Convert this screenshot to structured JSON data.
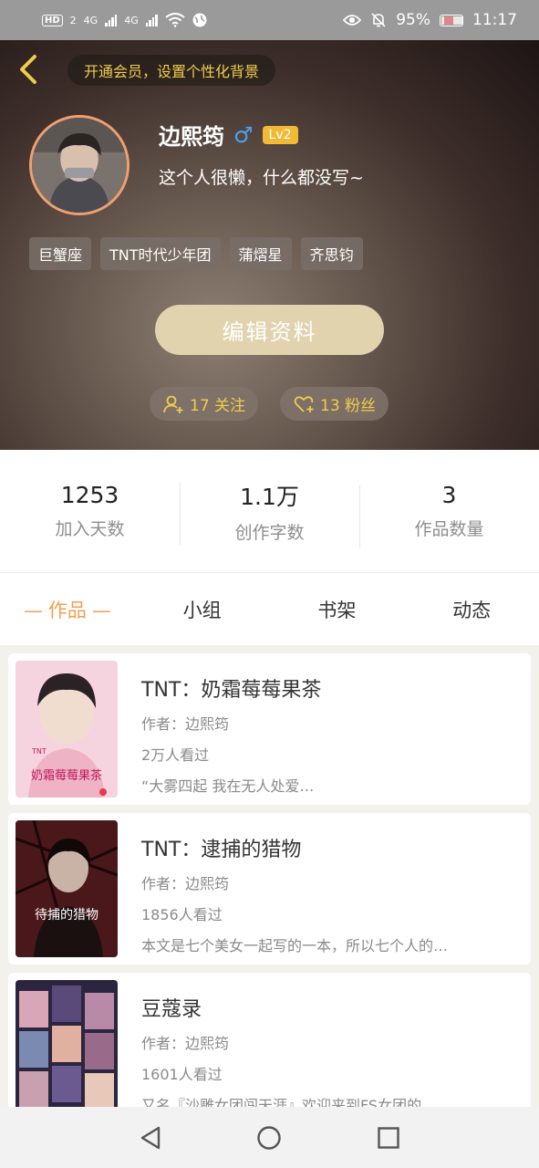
{
  "status_bar": {
    "hd": "HD",
    "sim": "2",
    "net1": "4G",
    "net2": "4G",
    "battery": "95%",
    "time": "11:17"
  },
  "header": {
    "vip_banner": "开通会员，设置个性化背景",
    "username": "边熙筠",
    "gender": "♂",
    "level": "Lv2",
    "bio": "这个人很懒，什么都没写~",
    "tags": [
      "巨蟹座",
      "TNT时代少年团",
      "蒲熠星",
      "齐思钧"
    ],
    "edit_label": "编辑资料",
    "following": "17 关注",
    "fans": "13 粉丝"
  },
  "stats": [
    {
      "value": "1253",
      "label": "加入天数"
    },
    {
      "value": "1.1万",
      "label": "创作字数"
    },
    {
      "value": "3",
      "label": "作品数量"
    }
  ],
  "tabs": [
    "作品",
    "小组",
    "书架",
    "动态"
  ],
  "works": [
    {
      "title": "TNT：奶霜莓莓果茶",
      "author": "作者：边熙筠",
      "views": "2万人看过",
      "summary": "“大雾四起 我在无人处爱…",
      "cover_text": "奶霜莓莓果茶",
      "cover_badge": "TNT"
    },
    {
      "title": "TNT：逮捕的猎物",
      "author": "作者：边熙筠",
      "views": "1856人看过",
      "summary": "本文是七个美女一起写的一本，所以七个人的…",
      "cover_text": "待捕的猎物"
    },
    {
      "title": "豆蔻录",
      "author": "作者：边熙筠",
      "views": "1601人看过",
      "summary": "又名『沙雕女团闯天涯』欢迎来到FS女团的…"
    }
  ],
  "colors": {
    "accent": "#f0a050",
    "gold": "#f0cc4a",
    "edit_button": "#e0d3ae",
    "gender": "#4aa3f0"
  }
}
